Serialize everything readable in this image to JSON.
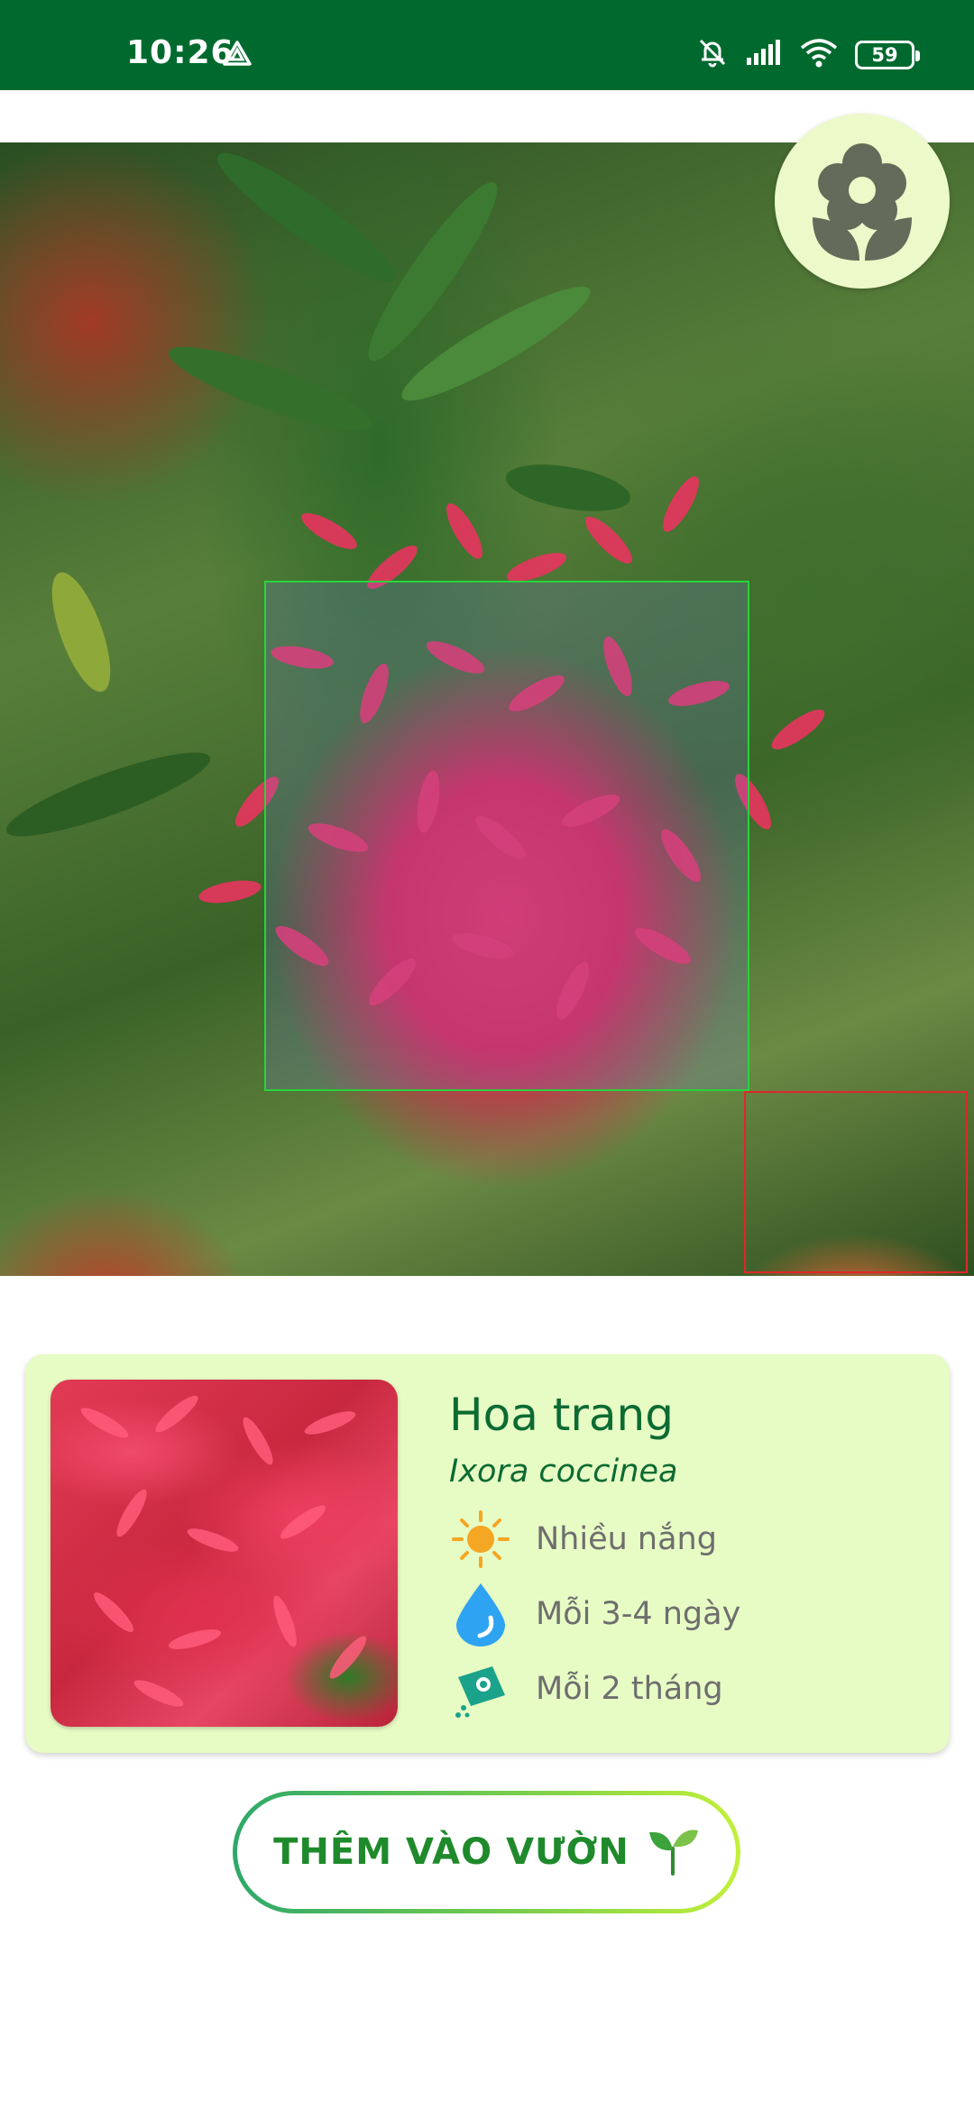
{
  "status_bar": {
    "time": "10:26",
    "battery": "59",
    "background_color": "#006a2e"
  },
  "photo": {
    "detections": [
      {
        "label_color": "#27d43a"
      },
      {
        "label_color": "#e0262a"
      }
    ]
  },
  "fab": {
    "icon": "flower-icon"
  },
  "plant": {
    "common_name": "Hoa trang",
    "scientific_name": "Ixora coccinea",
    "care": [
      {
        "icon": "sun-icon",
        "text": "Nhiều nắng"
      },
      {
        "icon": "water-drop-icon",
        "text": "Mỗi 3-4 ngày"
      },
      {
        "icon": "fertilizer-icon",
        "text": "Mỗi 2 tháng"
      }
    ]
  },
  "actions": {
    "add_to_garden": "THÊM VÀO VƯỜN",
    "add_icon": "sprout-icon"
  },
  "colors": {
    "primary": "#006a2e",
    "card_background": "#e7fbc4",
    "text_green": "#0b6b32"
  }
}
